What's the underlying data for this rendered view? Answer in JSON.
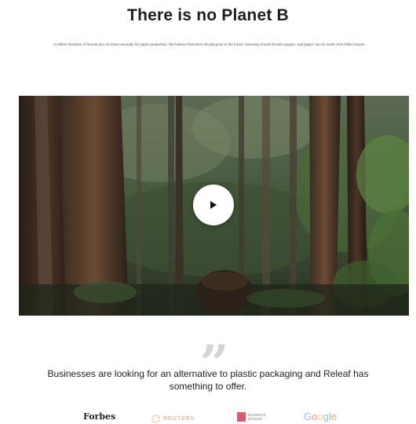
{
  "hero": {
    "title": "There is no Planet B",
    "subtitle": "3 million hectares of forests are cut down annually for paper production. We believe that trees should grow in the forest, humanity should breath oxygen, and paper can be made from fallen leaves."
  },
  "video": {
    "play_icon": "play-icon"
  },
  "testimonial": {
    "quote_mark": "”",
    "quote": "Businesses are looking for an alternative to plastic packaging and Releaf has something to offer."
  },
  "press": {
    "forbes": "Forbes",
    "reuters": "REUTERS",
    "business_insider": "BUSINESS INSIDER",
    "google": [
      "G",
      "o",
      "o",
      "g",
      "l",
      "e"
    ],
    "google_colors": [
      "#4285F4",
      "#EA4335",
      "#FBBC05",
      "#4285F4",
      "#34A853",
      "#EA4335"
    ]
  }
}
